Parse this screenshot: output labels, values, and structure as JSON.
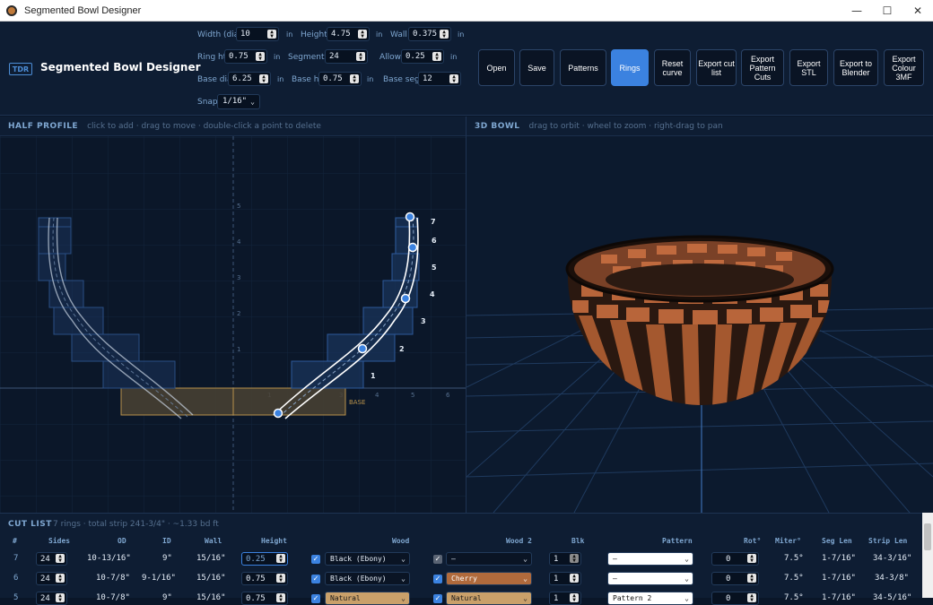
{
  "window": {
    "title": "Segmented Bowl Designer",
    "minimize": "—",
    "maximize": "☐",
    "close": "✕"
  },
  "header": {
    "badge": "TDR",
    "title": "Segmented Bowl Designer",
    "fields": {
      "width": {
        "label": "Width (dia)",
        "value": "10",
        "unit": "in"
      },
      "height": {
        "label": "Height",
        "value": "4.75",
        "unit": "in"
      },
      "wall": {
        "label": "Wall",
        "value": "0.375",
        "unit": "in"
      },
      "ring_ht": {
        "label": "Ring ht",
        "value": "0.75",
        "unit": "in"
      },
      "segments": {
        "label": "Segments",
        "value": "24"
      },
      "allow": {
        "label": "Allow",
        "value": "0.25",
        "unit": "in"
      },
      "base_dia": {
        "label": "Base dia",
        "value": "6.25",
        "unit": "in"
      },
      "base_ht": {
        "label": "Base ht",
        "value": "0.75",
        "unit": "in"
      },
      "base_segs": {
        "label": "Base segs",
        "value": "12"
      },
      "snap": {
        "label": "Snap",
        "value": "1/16\""
      }
    },
    "buttons": {
      "open": "Open",
      "save": "Save",
      "patterns": "Patterns",
      "rings": "Rings",
      "reset_curve": "Reset curve",
      "export_cut_list": "Export cut list",
      "export_pattern_cuts": "Export Pattern Cuts",
      "export_stl": "Export STL",
      "export_blender": "Export to Blender",
      "export_3mf": "Export Colour 3MF"
    }
  },
  "profile_panel": {
    "title": "HALF PROFILE",
    "hint": "click to add · drag to move · double-click a point to delete",
    "base_label": "BASE",
    "y_ticks": [
      "1",
      "2",
      "3",
      "4",
      "5"
    ],
    "x_ticks": [
      "1",
      "2",
      "3",
      "4",
      "5",
      "6"
    ],
    "ring_labels": [
      "1",
      "2",
      "3",
      "4",
      "5",
      "6",
      "7"
    ]
  },
  "view3d_panel": {
    "title": "3D BOWL",
    "hint": "drag to orbit · wheel to zoom · right-drag to pan"
  },
  "cutlist": {
    "title": "CUT LIST",
    "summary": "7 rings · total strip 241-3/4\" · ~1.33 bd ft",
    "columns": [
      "#",
      "Sides",
      "OD",
      "ID",
      "Wall",
      "Height",
      "Wood",
      "Wood 2",
      "Blk",
      "Pattern",
      "Rot°",
      "Miter°",
      "Seg Len",
      "Strip Len"
    ],
    "rows": [
      {
        "num": "7",
        "sides": "24",
        "od": "10-13/16\"",
        "id": "9\"",
        "wall": "15/16\"",
        "height": "0.25",
        "wood": "Black (Ebony)",
        "wood_color": "#0a1424",
        "wood_text": "#e6eef8",
        "wood2_on": false,
        "wood2": "—",
        "wood2_color": "#0a1424",
        "wood2_text": "#e6eef8",
        "blk": "1",
        "pattern": "—",
        "rot": "0",
        "miter": "7.5°",
        "seg_len": "1-7/16\"",
        "strip_len": "34-3/16\""
      },
      {
        "num": "6",
        "sides": "24",
        "od": "10-7/8\"",
        "id": "9-1/16\"",
        "wall": "15/16\"",
        "height": "0.75",
        "wood": "Black (Ebony)",
        "wood_color": "#0a1424",
        "wood_text": "#e6eef8",
        "wood2_on": true,
        "wood2": "Cherry",
        "wood2_color": "#b06a3c",
        "wood2_text": "#ffffff",
        "blk": "1",
        "pattern": "—",
        "rot": "0",
        "miter": "7.5°",
        "seg_len": "1-7/16\"",
        "strip_len": "34-3/8\""
      },
      {
        "num": "5",
        "sides": "24",
        "od": "10-7/8\"",
        "id": "9\"",
        "wall": "15/16\"",
        "height": "0.75",
        "wood": "Natural",
        "wood_color": "#c9a06a",
        "wood_text": "#1a1a1a",
        "wood2_on": true,
        "wood2": "Natural",
        "wood2_color": "#c9a06a",
        "wood2_text": "#1a1a1a",
        "blk": "1",
        "pattern": "Pattern 2",
        "rot": "0",
        "miter": "7.5°",
        "seg_len": "1-7/16\"",
        "strip_len": "34-5/16\""
      }
    ]
  }
}
